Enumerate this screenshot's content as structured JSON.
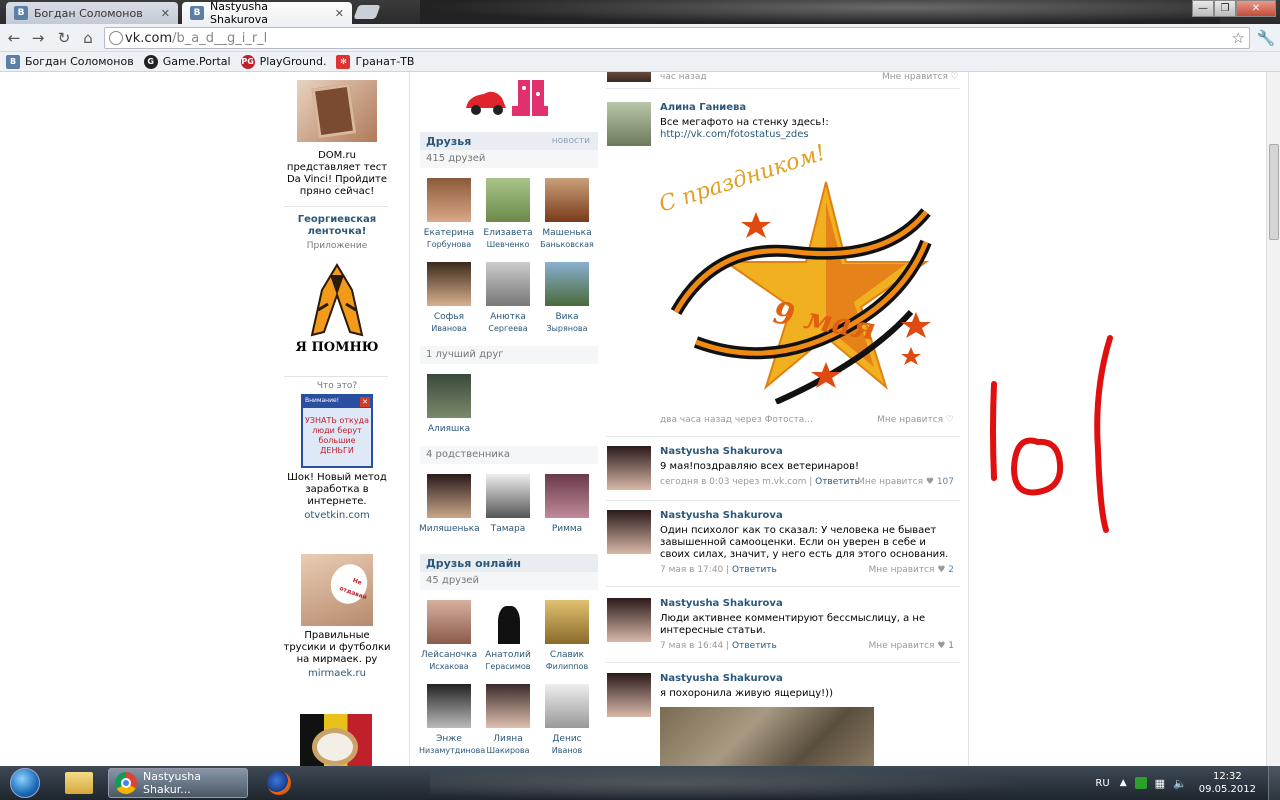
{
  "browser": {
    "tabs": [
      {
        "label": "Богдан Соломонов",
        "active": false
      },
      {
        "label": "Nastyusha Shakurova",
        "active": true
      }
    ],
    "url_domain": "vk.com",
    "url_path": "/b_a_d__g_i_r_l",
    "bookmarks": [
      "Богдан Соломонов",
      "Game.Portal",
      "PlayGround.",
      "Гранат-ТВ"
    ]
  },
  "ads": [
    {
      "text": "DOM.ru представляет тест Da Vinci! Пройдите пряно сейчас!"
    },
    {
      "title": "Георгиевская ленточка!",
      "subtitle": "Приложение",
      "caption": "Я ПОМНЮ"
    },
    {
      "question": "Что это?",
      "popup_title": "Внимание!",
      "popup_text": "УЗНАТЬ откуда люди берут большие ДЕНЬГИ",
      "text": "Шок! Новый метод заработка в интернете.",
      "link": "otvetkin.com"
    },
    {
      "text": "Правильные трусики и футболки на мирмаек. ру",
      "link": "mirmaek.ru",
      "sticker": "Не отдавай"
    }
  ],
  "friends": {
    "title": "Друзья",
    "more": "новости",
    "count": "415 друзей",
    "items": [
      {
        "first": "Екатерина",
        "last": "Горбунова"
      },
      {
        "first": "Елизавета",
        "last": "Шевченко"
      },
      {
        "first": "Машенька",
        "last": "Баньковская"
      },
      {
        "first": "Софья",
        "last": "Иванова"
      },
      {
        "first": "Анютка",
        "last": "Сергеева"
      },
      {
        "first": "Вика",
        "last": "Зырянова"
      }
    ],
    "best_label": "1 лучший друг",
    "best": [
      {
        "first": "Алияшка"
      }
    ],
    "relatives_label": "4 родственника",
    "relatives": [
      {
        "first": "Миляшенька"
      },
      {
        "first": "Тамара"
      },
      {
        "first": "Римма"
      }
    ],
    "online_title": "Друзья онлайн",
    "online_count": "45 друзей",
    "online": [
      {
        "first": "Лейсаночка",
        "last": "Исхакова"
      },
      {
        "first": "Анатолий",
        "last": "Герасимов"
      },
      {
        "first": "Славик",
        "last": "Филиппов"
      },
      {
        "first": "Энже",
        "last": "Низамутдинова"
      },
      {
        "first": "Лияна",
        "last": "Шакирова"
      },
      {
        "first": "Денис",
        "last": "Иванов"
      }
    ]
  },
  "wall": {
    "top_meta": "час назад",
    "top_like": "Мне нравится",
    "posts": [
      {
        "author": "Алина Ганиева",
        "text": "Все мегафото на стенку здесь!:",
        "link": "http://vk.com/fotostatus_zdes",
        "image_text_1": "С праздником!",
        "image_text_2": "9 мая",
        "meta": "два часа назад через Фотоста...",
        "like": "Мне нравится",
        "count": ""
      },
      {
        "author": "Nastyusha Shakurova",
        "text": "9 мая!поздравляю всех ветеринаров!",
        "meta": "сегодня в 0:03 через m.vk.com",
        "reply": "Ответить",
        "like": "Мне нравится",
        "count": "107"
      },
      {
        "author": "Nastyusha Shakurova",
        "text": "Один психолог как то сказал: У человека не бывает завышенной самооценки. Если он уверен в себе и своих силах, значит, у него есть для этого основания.",
        "meta": "7 мая в 17:40",
        "reply": "Ответить",
        "like": "Мне нравится",
        "count": "2"
      },
      {
        "author": "Nastyusha Shakurova",
        "text": "Люди активнее комментируют бессмыслицу, а не интересные статьи.",
        "meta": "7 мая в 16:44",
        "reply": "Ответить",
        "like": "Мне нравится",
        "count": "1"
      },
      {
        "author": "Nastyusha Shakurova",
        "text": "я похоронила живую ящерицу!))"
      }
    ]
  },
  "annotation": "lol",
  "taskbar": {
    "active_window": "Nastyusha Shakur...",
    "lang": "RU",
    "time": "12:32",
    "date": "09.05.2012"
  },
  "colors": {
    "vk_link": "#2b587a",
    "annotation_red": "#e01010"
  }
}
